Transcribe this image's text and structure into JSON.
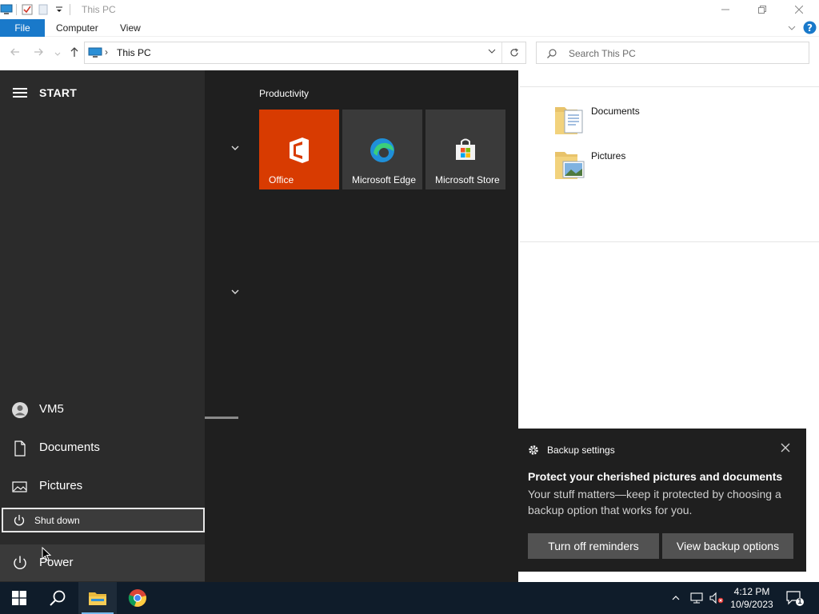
{
  "window": {
    "title": "This PC"
  },
  "ribbon": {
    "tabs": [
      {
        "label": "File"
      },
      {
        "label": "Computer"
      },
      {
        "label": "View"
      }
    ]
  },
  "address": {
    "crumb": "This PC",
    "search_placeholder": "Search This PC"
  },
  "folders": [
    {
      "name": "Documents",
      "icon": "documents-folder-icon"
    },
    {
      "name": "Pictures",
      "icon": "pictures-folder-icon"
    }
  ],
  "start_menu": {
    "label": "START",
    "user": "VM5",
    "places": [
      {
        "label": "Documents",
        "icon": "document-icon"
      },
      {
        "label": "Pictures",
        "icon": "image-icon"
      }
    ],
    "shutdown_label": "Shut down",
    "power_label": "Power",
    "group_title": "Productivity",
    "tiles": [
      {
        "label": "Office",
        "color": "#d83b01"
      },
      {
        "label": "Microsoft Edge",
        "color": "#3a3a3a"
      },
      {
        "label": "Microsoft Store",
        "color": "#3a3a3a"
      }
    ]
  },
  "toast": {
    "app": "Backup settings",
    "title": "Protect your cherished pictures and documents",
    "body": "Your stuff matters—keep it protected by choosing a backup option that works for you.",
    "buttons": [
      {
        "label": "Turn off reminders"
      },
      {
        "label": "View backup options"
      }
    ]
  },
  "taskbar": {
    "time": "4:12 PM",
    "date": "10/9/2023",
    "notification_count": "1"
  },
  "colors": {
    "accent": "#1979ca",
    "office": "#d83b01",
    "taskbar": "#0f1c2a"
  }
}
